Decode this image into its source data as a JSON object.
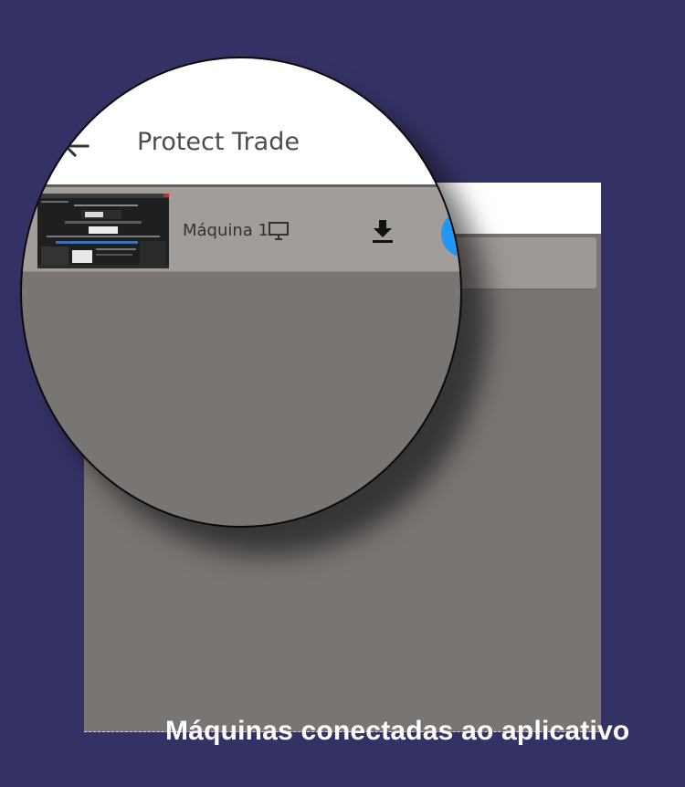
{
  "app": {
    "title": "Protect Trade"
  },
  "machines": [
    {
      "label": "Máquina 1",
      "status_icon": "monitor-icon",
      "action_icon": "download-icon"
    }
  ],
  "caption": "Máquinas conectadas ao aplicativo",
  "colors": {
    "background": "#343264",
    "screen": "#797573",
    "row": "#a39d9a",
    "header": "#ffffff",
    "fab": "#2196f3"
  }
}
